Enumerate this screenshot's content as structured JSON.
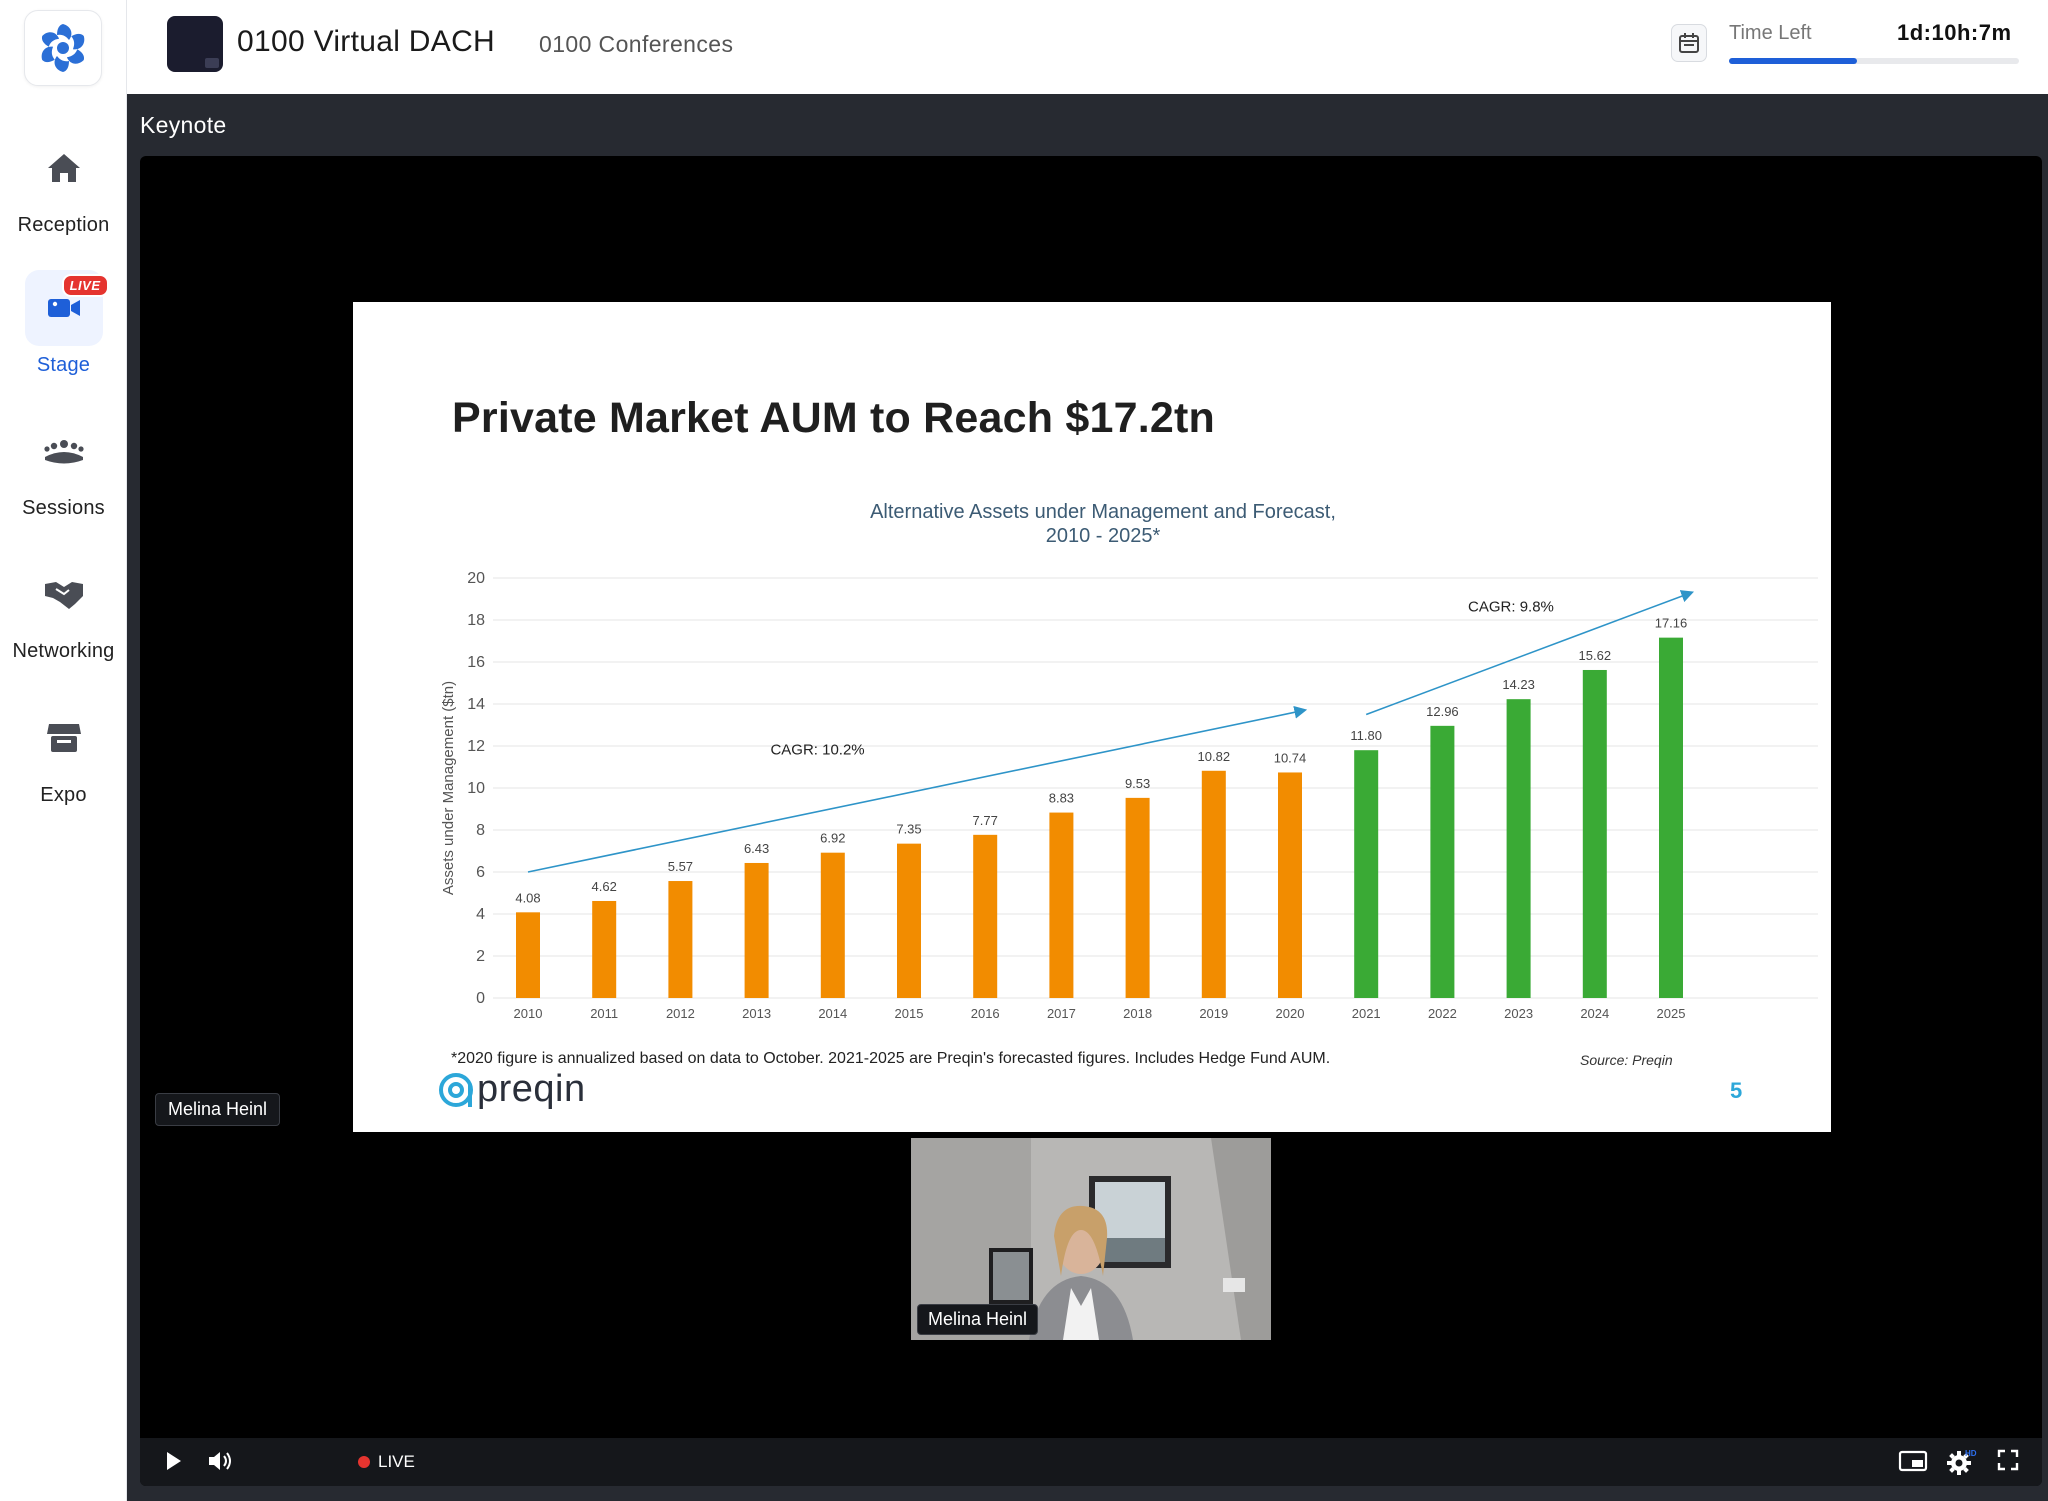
{
  "sidebar": {
    "items": [
      {
        "label": "Reception",
        "icon": "home-icon"
      },
      {
        "label": "Stage",
        "icon": "video-camera-icon",
        "badge": "LIVE",
        "active": true
      },
      {
        "label": "Sessions",
        "icon": "people-group-icon"
      },
      {
        "label": "Networking",
        "icon": "handshake-icon"
      },
      {
        "label": "Expo",
        "icon": "booth-icon"
      }
    ]
  },
  "header": {
    "event_title": "0100 Virtual DACH",
    "organizer": "0100 Conferences",
    "time_left_label": "Time Left",
    "time_left_value": "1d:10h:7m",
    "time_progress": 0.44
  },
  "stage": {
    "section_title": "Keynote",
    "presenter_tag": "Melina Heinl",
    "webcam_name": "Melina Heinl",
    "live_label": "LIVE"
  },
  "slide": {
    "title": "Private Market AUM to Reach $17.2tn",
    "footnote": "*2020 figure is annualized based on data to October. 2021-2025 are Preqin's forecasted figures. Includes Hedge Fund AUM.",
    "source": "Source: Preqin",
    "brand": "preqin",
    "page_number": "5"
  },
  "chart_data": {
    "type": "bar",
    "title": "Alternative Assets under Management and Forecast,",
    "subtitle": "2010 - 2025*",
    "xlabel": "",
    "ylabel": "Assets under Management ($tn)",
    "ylim": [
      0,
      20
    ],
    "yticks": [
      0,
      2,
      4,
      6,
      8,
      10,
      12,
      14,
      16,
      18,
      20
    ],
    "categories": [
      "2010",
      "2011",
      "2012",
      "2013",
      "2014",
      "2015",
      "2016",
      "2017",
      "2018",
      "2019",
      "2020",
      "2021",
      "2022",
      "2023",
      "2024",
      "2025"
    ],
    "values": [
      4.08,
      4.62,
      5.57,
      6.43,
      6.92,
      7.35,
      7.77,
      8.83,
      9.53,
      10.82,
      10.74,
      11.8,
      12.96,
      14.23,
      15.62,
      17.16
    ],
    "value_labels": [
      "4.08",
      "4.62",
      "5.57",
      "6.43",
      "6.92",
      "7.35",
      "7.77",
      "8.83",
      "9.53",
      "10.82",
      "10.74",
      "11.80",
      "12.96",
      "14.23",
      "15.62",
      "17.16"
    ],
    "forecast_from_index": 11,
    "colors": {
      "historical": "#f28c00",
      "forecast": "#3aaa35",
      "trend": "#2e94c8"
    },
    "grid": true,
    "annotations": [
      {
        "text": "CAGR: 10.2%",
        "from": [
          2010,
          6.0
        ],
        "to": [
          2020,
          13.7
        ]
      },
      {
        "text": "CAGR: 9.8%",
        "from": [
          2021,
          13.5
        ],
        "to": [
          2025,
          19.3
        ]
      }
    ]
  },
  "controls": {
    "play_icon": "play-icon",
    "volume_icon": "volume-icon",
    "pip_icon": "picture-in-picture-icon",
    "settings_icon": "settings-icon",
    "hd_badge": "HD",
    "fullscreen_icon": "fullscreen-icon"
  }
}
